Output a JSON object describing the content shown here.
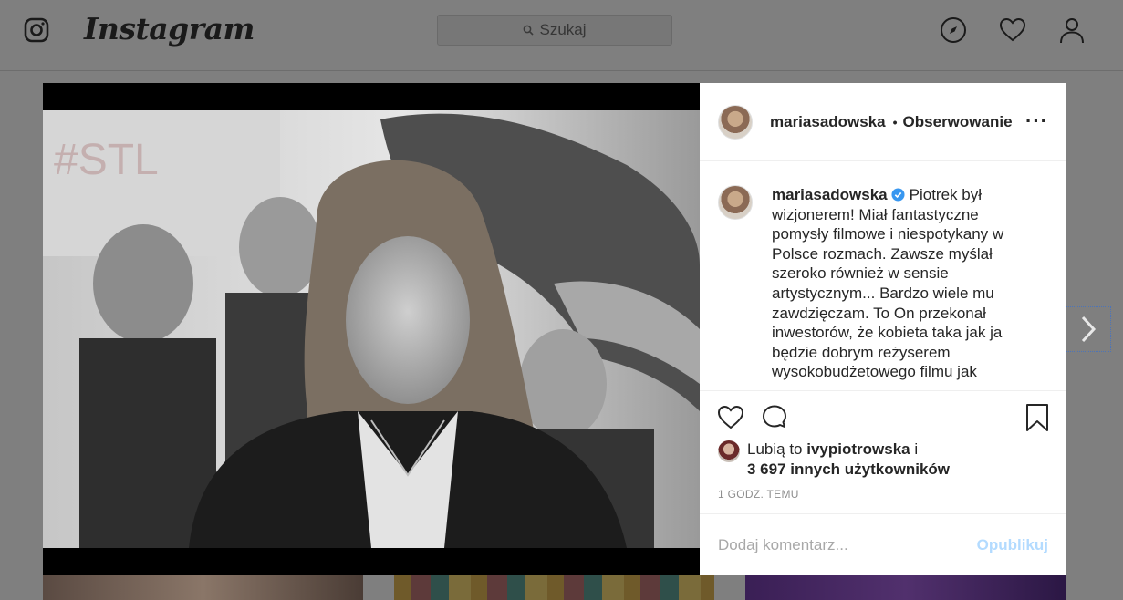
{
  "topbar": {
    "logo_icon": "instagram-glyph-icon",
    "wordmark": "Instagram",
    "search_placeholder": "Szukaj",
    "nav_icons": [
      "compass-icon",
      "heart-icon",
      "profile-icon"
    ]
  },
  "post": {
    "username": "mariasadowska",
    "follow_label": "Obserwowanie",
    "dot": "•",
    "caption": "Piotrek był wizjonerem! Miał fantastyczne pomysły filmowe i niespotykany w Polsce rozmach. Zawsze myślał szeroko również w sensie artystycznym... Bardzo wiele mu zawdzięczam. To On przekonał inwestorów, że kobieta taka jak ja będzie dobrym reżyserem wysokobudżetowego filmu jak",
    "likes_prefix": "Lubią to",
    "likes_user": "ivypiotrowska",
    "likes_connector": "i",
    "likes_others": "3 697 innych użytkowników",
    "time": "1 GODZ. TEMU",
    "comment_placeholder": "Dodaj komentarz...",
    "publish_label": "Opublikuj"
  },
  "colors": {
    "overlay_gray": "#7f7f7f",
    "verified_blue": "#3897f0",
    "publish_disabled": "#b3dbff",
    "muted_text": "#8e8e8e"
  }
}
